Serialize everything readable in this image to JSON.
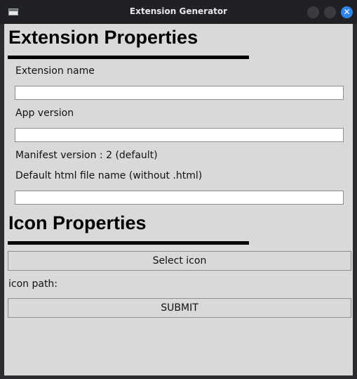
{
  "window": {
    "title": "Extension Generator"
  },
  "extension_section": {
    "heading": "Extension Properties",
    "name_label": "Extension name",
    "name_value": "",
    "version_label": "App version",
    "version_value": "",
    "manifest_label": "Manifest version : 2 (default)",
    "html_label": "Default html file name (without .html)",
    "html_value": ""
  },
  "icon_section": {
    "heading": "Icon Properties",
    "select_button": "Select icon",
    "path_label": "icon path:",
    "submit_button": "SUBMIT"
  },
  "colors": {
    "titlebar": "#202124",
    "content_bg": "#d9d9d9",
    "close_button": "#2f86e8"
  }
}
